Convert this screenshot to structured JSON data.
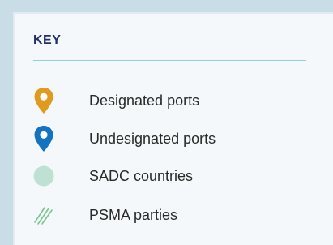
{
  "key": {
    "title": "KEY",
    "items": [
      {
        "label": "Designated ports",
        "icon": "map-pin-icon",
        "color": "#e09a1e"
      },
      {
        "label": "Undesignated ports",
        "icon": "map-pin-icon",
        "color": "#1273c0"
      },
      {
        "label": "SADC countries",
        "icon": "circle-icon",
        "color": "#bfe1d3"
      },
      {
        "label": "PSMA parties",
        "icon": "hatch-lines-icon",
        "color": "#7cc48e"
      }
    ]
  }
}
